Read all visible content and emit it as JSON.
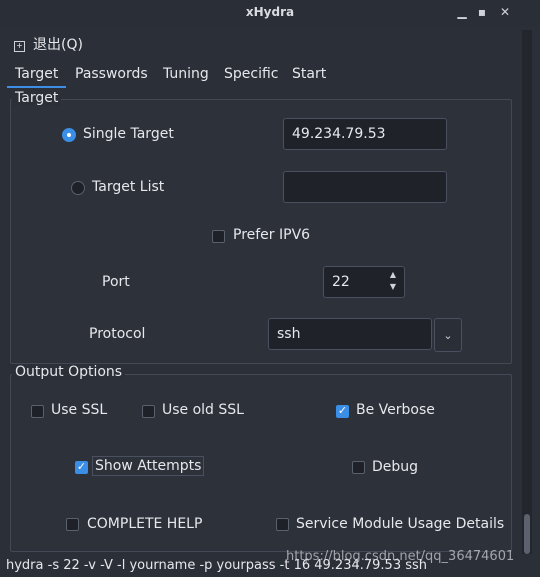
{
  "window": {
    "title": "xHydra"
  },
  "menu": {
    "quit_label": "退出(Q)"
  },
  "tabs": [
    {
      "label": "Target",
      "active": true
    },
    {
      "label": "Passwords",
      "active": false
    },
    {
      "label": "Tuning",
      "active": false
    },
    {
      "label": "Specific",
      "active": false
    },
    {
      "label": "Start",
      "active": false
    }
  ],
  "target_group": {
    "title": "Target",
    "single_target": {
      "label": "Single Target",
      "selected": true,
      "value": "49.234.79.53"
    },
    "target_list": {
      "label": "Target List",
      "selected": false,
      "value": ""
    },
    "prefer_ipv6": {
      "label": "Prefer IPV6",
      "checked": false
    },
    "port": {
      "label": "Port",
      "value": "22"
    },
    "protocol": {
      "label": "Protocol",
      "value": "ssh"
    }
  },
  "output_group": {
    "title": "Output Options",
    "use_ssl": {
      "label": "Use SSL",
      "checked": false
    },
    "use_old_ssl": {
      "label": "Use old SSL",
      "checked": false
    },
    "be_verbose": {
      "label": "Be Verbose",
      "checked": true
    },
    "show_attempts": {
      "label": "Show Attempts",
      "checked": true
    },
    "debug": {
      "label": "Debug",
      "checked": false
    },
    "complete_help": {
      "label": "COMPLETE HELP",
      "checked": false
    },
    "service_module": {
      "label": "Service Module Usage Details",
      "checked": false
    }
  },
  "status": {
    "command": "hydra -s 22 -v -V -l yourname -p yourpass -t 16 49.234.79.53 ssh"
  },
  "watermark": "https://blog.csdn.net/qq_36474601",
  "colors": {
    "accent": "#3a8ee6",
    "background": "#2b2f38"
  },
  "icons": {
    "minimize": "minimize-icon",
    "maximize": "maximize-icon",
    "close": "close-icon",
    "combo": "chevron-down-icon"
  }
}
